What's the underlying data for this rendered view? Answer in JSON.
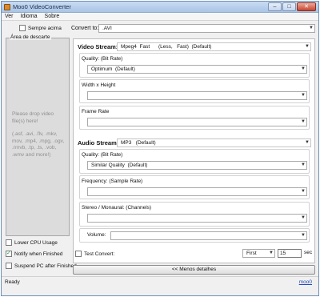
{
  "window": {
    "title": "Moo0 VideoConverter",
    "minimize": "–",
    "maximize": "□",
    "close": "✕"
  },
  "menu": [
    "Ver",
    "Idioma",
    "Sobre"
  ],
  "options": {
    "always_on_top": {
      "label": "Sempre acima",
      "checked": false
    },
    "lower_cpu": {
      "label": "Lower CPU Usage",
      "checked": false
    },
    "notify_finished": {
      "label": "Notify when Finished",
      "checked": true
    },
    "suspend_pc": {
      "label": "Suspend PC after Finished",
      "checked": false
    }
  },
  "drop_area": {
    "label": "Área de descarte",
    "hint": "Please drop video file(s) here!",
    "formats": "(.asf, .avi, .flv, .mkv, mov, .mp4, .mpg, .ogv, .rmvb, .tp, .ts, .vob, .wmv and more!)"
  },
  "convert_to": {
    "label": "Convert to:",
    "value": ".AVI"
  },
  "video_stream": {
    "label": "Video Stream:",
    "value": "Mpeg4  Fast      (Less,   Fast)  (Default)",
    "quality_label": "Quality:  (Bit Rate)",
    "quality_value": "Optimum  (Default)",
    "size_label": "Width x Height",
    "size_value": "",
    "framerate_label": "Frame Rate",
    "framerate_value": ""
  },
  "audio_stream": {
    "label": "Audio Stream:",
    "value": "MP3   (Default)",
    "quality_label": "Quality:  (Bit Rate)",
    "quality_value": "Similar Quality  (Default)",
    "frequency_label": "Frequency:  (Sample Rate)",
    "frequency_value": "",
    "channels_label": "Stereo / Monaural:  (Channels)",
    "channels_value": "",
    "volume_label": "Volume:",
    "volume_value": ""
  },
  "test_convert": {
    "label": "Test Convert:",
    "checked": false,
    "position": "First",
    "seconds": "15",
    "unit": "sec"
  },
  "less_details_button": "<< Menos detalhes",
  "status": {
    "text": "Ready",
    "link": "moo0"
  }
}
